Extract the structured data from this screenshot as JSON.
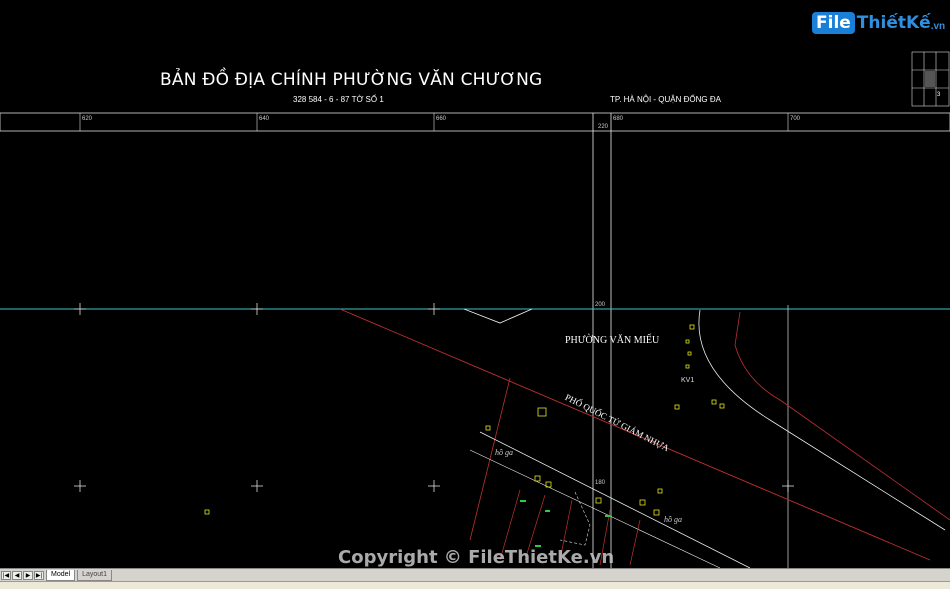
{
  "drawing": {
    "title": "BẢN ĐỒ ĐỊA CHÍNH PHƯỜNG VĂN CHƯƠNG",
    "sheet_code": "328 584 - 6 - 87 TỜ SỐ 1",
    "city": "TP. HÀ NỘI - QUẬN ĐỐNG ĐA",
    "ruler_labels": [
      "620",
      "640",
      "660",
      "680",
      "700"
    ],
    "vertical_labels": [
      "220",
      "200",
      "180"
    ],
    "ward_label": "PHƯỜNG VĂN MIẾU",
    "street_label": "PHỐ QUỐC TỬ GIÁM NHỰA",
    "annotations": [
      "KV1",
      "hồ ga",
      "hồ ga"
    ],
    "index_grid_number": "3"
  },
  "logo": {
    "file_label": "File",
    "rest_label": "ThiếtKế",
    "tld_label": ".vn"
  },
  "watermark": "Copyright © FileThietKe.vn",
  "layout_tabs": [
    {
      "label": "Model",
      "active": true
    },
    {
      "label": "Layout1",
      "active": false
    }
  ],
  "colors": {
    "background": "#000000",
    "grid_line": "#ffffff",
    "cyan_line": "#37c8c8",
    "road_red": "#c03030",
    "parcel_yellow": "#e6e61e"
  }
}
